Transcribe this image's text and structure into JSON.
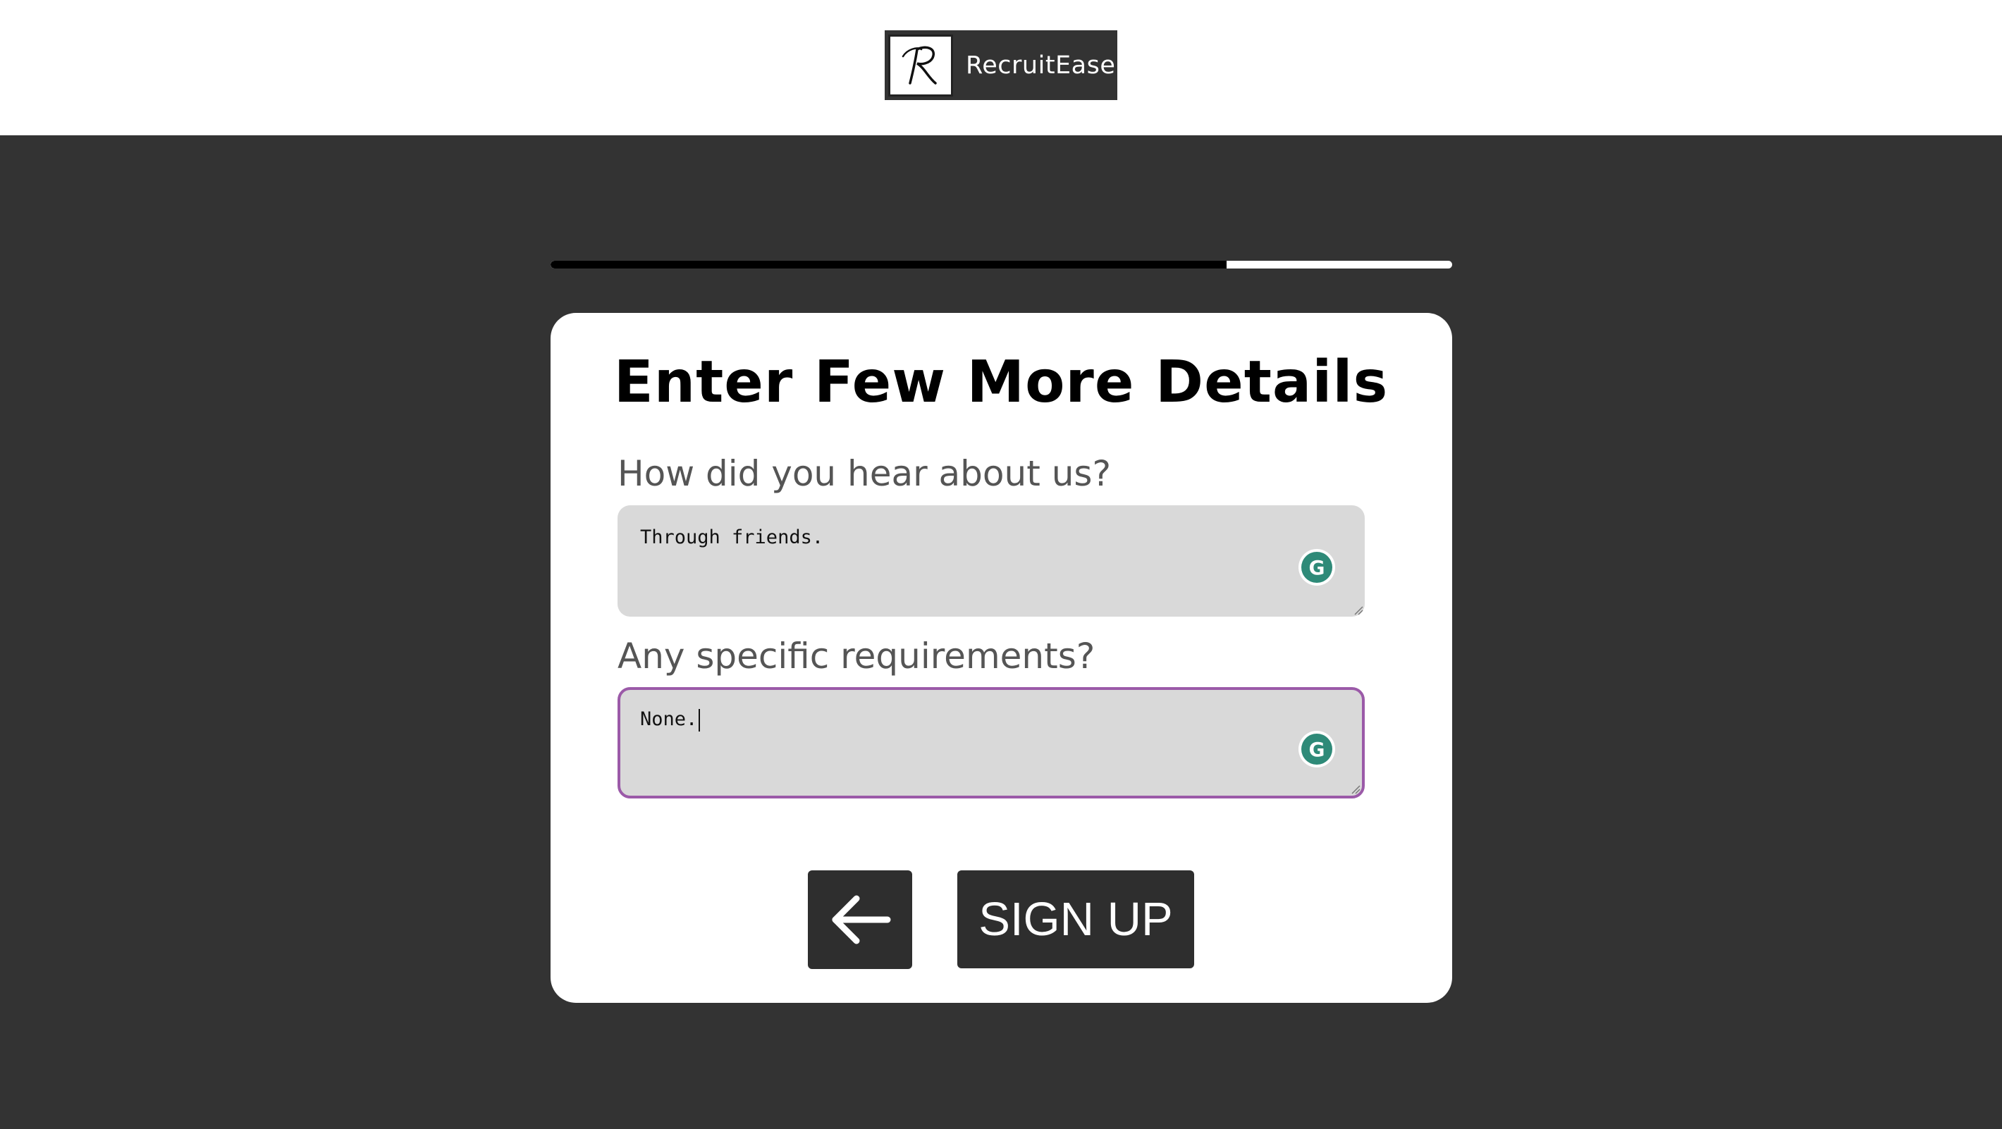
{
  "brand": {
    "name": "RecruitEase",
    "logo_letter": "R"
  },
  "progress": {
    "fraction": 0.75
  },
  "form": {
    "title": "Enter Few More Details",
    "fields": [
      {
        "label": "How did you hear about us?",
        "value": "Through friends.",
        "focused": false
      },
      {
        "label": "Any specific requirements?",
        "value": "None.",
        "focused": true
      }
    ],
    "back_icon": "arrow-left-icon",
    "signup_label": "SIGN UP",
    "grammarly_letter": "G"
  },
  "colors": {
    "background": "#333333",
    "button": "#2e2e2e",
    "focus_border": "#9b5aa8",
    "grammarly": "#2e8a78"
  }
}
